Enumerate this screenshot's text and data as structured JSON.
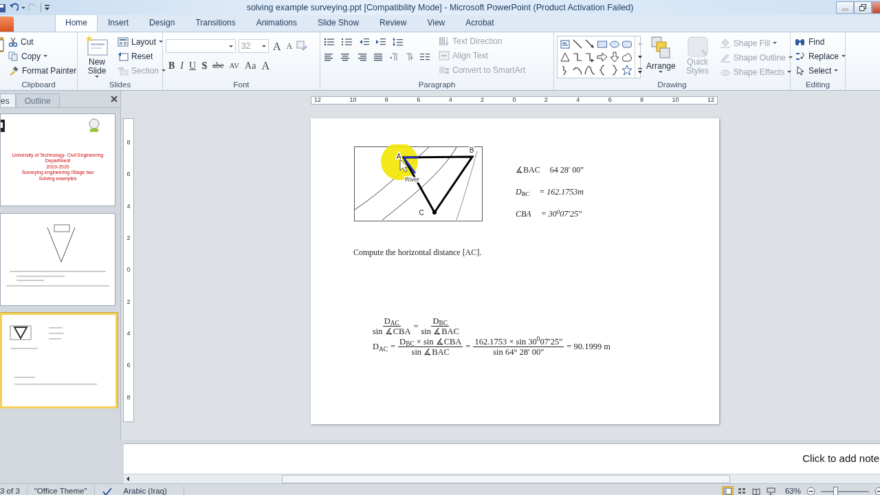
{
  "window": {
    "title": "solving example surveying.ppt [Compatibility Mode]  -  Microsoft PowerPoint (Product Activation Failed)"
  },
  "ribbon_tabs": [
    {
      "label": "Home",
      "selected": true
    },
    {
      "label": "Insert",
      "selected": false
    },
    {
      "label": "Design",
      "selected": false
    },
    {
      "label": "Transitions",
      "selected": false
    },
    {
      "label": "Animations",
      "selected": false
    },
    {
      "label": "Slide Show",
      "selected": false
    },
    {
      "label": "Review",
      "selected": false
    },
    {
      "label": "View",
      "selected": false
    },
    {
      "label": "Acrobat",
      "selected": false
    }
  ],
  "clipboard_group": {
    "label": "Clipboard",
    "items": [
      {
        "label": "Cut",
        "disabled": false,
        "dropdown": false
      },
      {
        "label": "Copy",
        "disabled": false,
        "dropdown": true
      },
      {
        "label": "Format Painter",
        "disabled": false,
        "dropdown": false
      }
    ]
  },
  "slides_group": {
    "label": "Slides",
    "new_slide": "New Slide",
    "items": [
      {
        "label": "Layout",
        "disabled": false,
        "dropdown": true
      },
      {
        "label": "Reset",
        "disabled": false,
        "dropdown": false
      },
      {
        "label": "Section",
        "disabled": true,
        "dropdown": true
      }
    ]
  },
  "font_group": {
    "label": "Font",
    "font_size": "32",
    "size_buttons": [
      "A",
      "A"
    ],
    "format_buttons": [
      {
        "label": "B",
        "kind": "bold"
      },
      {
        "label": "I",
        "kind": "italic"
      },
      {
        "label": "U",
        "kind": "underline"
      },
      {
        "label": "S",
        "kind": "shadow"
      },
      {
        "label": "abe",
        "kind": "strike"
      },
      {
        "label": "AV",
        "kind": "spacing"
      },
      {
        "label": "Aa",
        "kind": "case"
      },
      {
        "label": "A",
        "kind": "color"
      }
    ]
  },
  "paragraph_group": {
    "label": "Paragraph",
    "items": [
      {
        "label": "Text Direction",
        "disabled": true
      },
      {
        "label": "Align Text",
        "disabled": true
      },
      {
        "label": "Convert to SmartArt",
        "disabled": true
      }
    ]
  },
  "drawing_group": {
    "label": "Drawing",
    "arrange": "Arrange",
    "quick_styles": {
      "label": "Quick Styles",
      "disabled": true
    },
    "items": [
      {
        "label": "Shape Fill",
        "disabled": true
      },
      {
        "label": "Shape Outline",
        "disabled": true
      },
      {
        "label": "Shape Effects",
        "disabled": true
      }
    ]
  },
  "editing_group": {
    "label": "Editing",
    "items": [
      {
        "label": "Find",
        "dropdown": false
      },
      {
        "label": "Replace",
        "dropdown": true
      },
      {
        "label": "Select",
        "dropdown": true
      }
    ]
  },
  "pane_tabs": [
    {
      "label": "es",
      "selected": true
    },
    {
      "label": "Outline",
      "selected": false
    }
  ],
  "thumbnails": [
    {
      "selected": false,
      "lines": [
        "University of Technology- Civil Engineering Department",
        "2019-2020",
        "Surveying engineering  /Stage two",
        "Solving examples"
      ]
    },
    {
      "selected": false
    },
    {
      "selected": true
    }
  ],
  "ruler": {
    "top_labels": [
      "12",
      "10",
      "8",
      "6",
      "4",
      "2",
      "0",
      "2",
      "4",
      "6",
      "8",
      "10",
      "12"
    ],
    "side_labels": [
      "8",
      "6",
      "4",
      "2",
      "0",
      "2",
      "4",
      "6",
      "8"
    ]
  },
  "slide": {
    "points": [
      {
        "label": "A"
      },
      {
        "label": "B"
      },
      {
        "label": "C"
      }
    ],
    "river_label": "River",
    "givens": [
      {
        "name": "∡BAC",
        "value": "64 28′ 00″",
        "italic": false
      },
      {
        "name": "D$_{BC}$",
        "value": "= 162.1753m",
        "italic": true
      },
      {
        "name": "CBA",
        "value": "= 30$^{0}$07′25\"",
        "italic": true
      }
    ],
    "prompt": "Compute the horizontal distance [AC].",
    "equations": [
      [
        {
          "kind": "frac",
          "num": "D$_{AC}$",
          "den": "sin ∡CBA"
        },
        {
          "kind": "op",
          "text": "="
        },
        {
          "kind": "frac",
          "num": "D$_{BC}$",
          "den": "sin ∡BAC"
        }
      ],
      [
        {
          "kind": "term",
          "text": "D$_{AC}$"
        },
        {
          "kind": "op",
          "text": "="
        },
        {
          "kind": "frac",
          "num": "D$_{BC}$ × sin ∡CBA",
          "den": "sin ∡BAC"
        },
        {
          "kind": "op",
          "text": "="
        },
        {
          "kind": "frac",
          "num": "162.1753 × sin 30$^{0}$07′25\"",
          "den": "sin 64° 28′ 00″"
        },
        {
          "kind": "op",
          "text": "= 90.1999 m"
        }
      ]
    ]
  },
  "notes": {
    "placeholder": "Click to add note"
  },
  "status_bar": {
    "slide_count": "3 of 3",
    "theme": "\"Office Theme\"",
    "language": "Arabic (Iraq)",
    "zoom": "63%",
    "zoom_slider": {
      "level": 0.3
    },
    "views": [
      {
        "selected": true
      },
      {
        "selected": false
      },
      {
        "selected": false
      },
      {
        "selected": false
      }
    ]
  }
}
